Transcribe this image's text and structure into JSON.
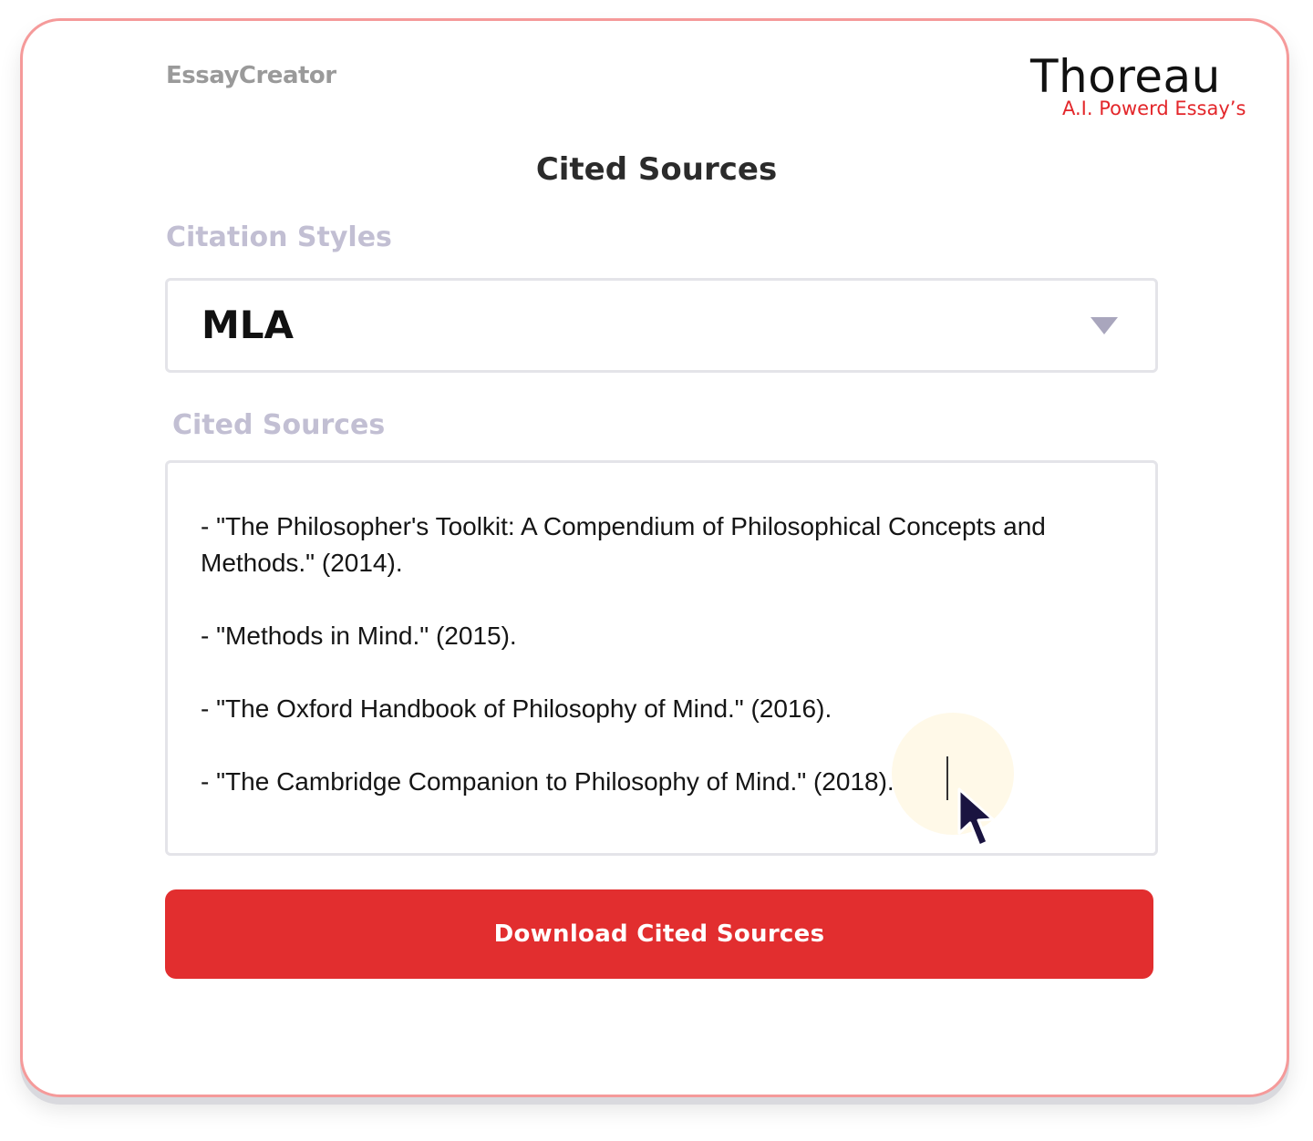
{
  "app": {
    "name": "EssayCreator"
  },
  "brand": {
    "title": "Thoreau",
    "tagline": "A.I. Powerd Essay’s",
    "tagline_color": "#e3262a"
  },
  "page": {
    "title": "Cited Sources"
  },
  "citation_styles": {
    "label": "Citation Styles",
    "selected": "MLA",
    "caret_icon": "chevron-down-icon"
  },
  "cited_sources": {
    "label": "Cited Sources",
    "lines": [
      "- \"The Philosopher's Toolkit: A Compendium of Philosophical Concepts and",
      "Methods.\" (2014).",
      "- \"Methods in Mind.\" (2015).",
      "- \"The Oxford Handbook of Philosophy of Mind.\" (2016).",
      "- \"The Cambridge Companion to Philosophy of Mind.\" (2018)."
    ]
  },
  "actions": {
    "download_label": "Download Cited Sources",
    "download_color": "#e22e2f"
  },
  "colors": {
    "card_border": "#f59a9a",
    "label_color": "#c2bfd3",
    "pointer_color": "#1a1440"
  }
}
